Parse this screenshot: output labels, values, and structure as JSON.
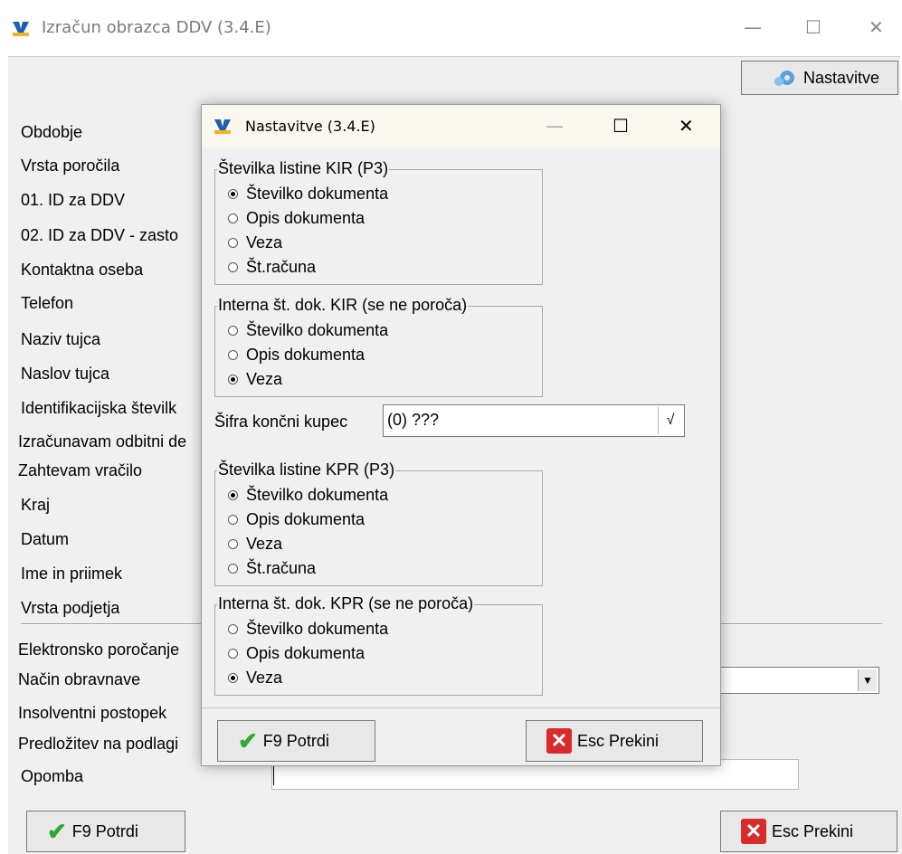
{
  "window": {
    "title": "Izračun obrazca DDV  (3.4.E)",
    "minimize": "—",
    "maximize": "☐",
    "close": "✕"
  },
  "toolbar": {
    "settings_label": "Nastavitve"
  },
  "form": {
    "labels": [
      "Obdobje",
      "Vrsta poročila",
      "01. ID za DDV",
      "02. ID za DDV - zasto",
      "Kontaktna oseba",
      "Telefon",
      "Naziv tujca",
      "Naslov tujca",
      "Identifikacijska številk",
      "Izračunavam odbitni de",
      "Zahtevam vračilo",
      "Kraj",
      "Datum",
      "Ime in priimek",
      "Vrsta podjetja",
      "Elektronsko poročanje",
      "Način obravnave",
      "Insolventni postopek",
      "Predložitev na podlagi",
      "Opomba"
    ],
    "nacin_value": "",
    "opomba_value": ""
  },
  "footer": {
    "confirm_label": "F9 Potrdi",
    "cancel_label": "Esc Prekini"
  },
  "dialog": {
    "title": "Nastavitve  (3.4.E)",
    "minimize": "—",
    "maximize": "☐",
    "close": "✕",
    "groups": [
      {
        "legend": "Številka listine KIR (P3)",
        "options": [
          "Številko dokumenta",
          "Opis dokumenta",
          "Veza",
          "Št.računa"
        ],
        "selected": 0
      },
      {
        "legend": "Interna št. dok. KIR (se ne poroča)",
        "options": [
          "Številko dokumenta",
          "Opis dokumenta",
          "Veza"
        ],
        "selected": 2
      },
      {
        "legend": "Številka listine KPR (P3)",
        "options": [
          "Številko dokumenta",
          "Opis dokumenta",
          "Veza",
          "Št.računa"
        ],
        "selected": 0
      },
      {
        "legend": "Interna št. dok. KPR (se ne poroča)",
        "options": [
          "Številko dokumenta",
          "Opis dokumenta",
          "Veza"
        ],
        "selected": 2
      }
    ],
    "sifra_label": "Šifra končni kupec",
    "sifra_value": "(0) ???",
    "sifra_button": "√",
    "confirm_label": "F9 Potrdi",
    "cancel_label": "Esc Prekini"
  },
  "colors": {
    "accent_check": "#2fa82f",
    "cancel_red": "#d92b2b",
    "dialog_title_bg": "#faf7ef"
  }
}
